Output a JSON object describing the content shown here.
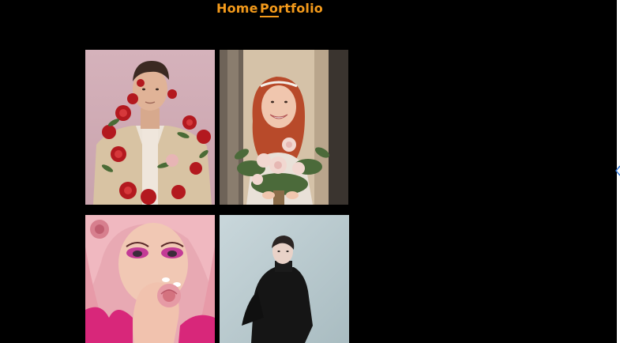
{
  "nav": {
    "items": [
      {
        "label": "Home",
        "active": false
      },
      {
        "label": "Portfolio",
        "active": true
      }
    ]
  },
  "gallery": {
    "photos": [
      {
        "subject": "man-with-roses-photo"
      },
      {
        "subject": "bride-with-bouquet-photo"
      },
      {
        "subject": "pink-hair-woman-with-rose-photo"
      },
      {
        "subject": "man-in-black-coat-photo"
      }
    ]
  },
  "colors": {
    "background": "#000000",
    "nav_accent": "#f39a1b",
    "edge_arrow": "#3a7bd5"
  },
  "icons": {
    "edge_arrow": "chevron-left-icon"
  }
}
